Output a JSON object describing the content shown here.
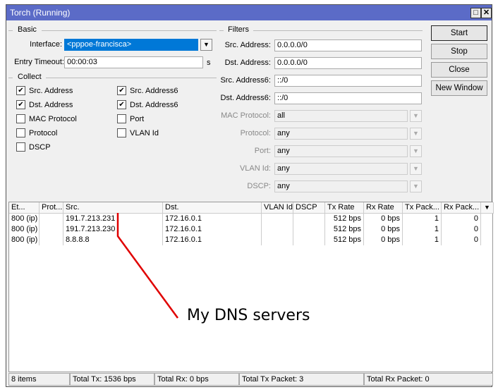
{
  "window": {
    "title": "Torch (Running)",
    "maximize_icon": "□",
    "close_icon": "✕"
  },
  "basic": {
    "label": "Basic",
    "interface_label": "Interface:",
    "interface_value": "<pppoe-francisca>",
    "entry_timeout_label": "Entry Timeout:",
    "entry_timeout_value": "00:00:03",
    "timeout_unit": "s"
  },
  "collect": {
    "label": "Collect",
    "items": [
      {
        "label": "Src. Address",
        "checked": true
      },
      {
        "label": "Dst. Address",
        "checked": true
      },
      {
        "label": "MAC Protocol",
        "checked": false
      },
      {
        "label": "Protocol",
        "checked": false
      },
      {
        "label": "DSCP",
        "checked": false
      },
      {
        "label": "Src. Address6",
        "checked": true
      },
      {
        "label": "Dst. Address6",
        "checked": true
      },
      {
        "label": "Port",
        "checked": false
      },
      {
        "label": "VLAN Id",
        "checked": false
      }
    ]
  },
  "filters": {
    "label": "Filters",
    "fields": [
      {
        "label": "Src. Address:",
        "value": "0.0.0.0/0"
      },
      {
        "label": "Dst. Address:",
        "value": "0.0.0.0/0"
      },
      {
        "label": "Src. Address6:",
        "value": "::/0"
      },
      {
        "label": "Dst. Address6:",
        "value": "::/0"
      },
      {
        "label": "MAC Protocol:",
        "value": "all"
      },
      {
        "label": "Protocol:",
        "value": "any"
      },
      {
        "label": "Port:",
        "value": "any"
      },
      {
        "label": "VLAN Id:",
        "value": "any"
      },
      {
        "label": "DSCP:",
        "value": "any"
      }
    ]
  },
  "buttons": {
    "start": "Start",
    "stop": "Stop",
    "close": "Close",
    "new_window": "New Window"
  },
  "table": {
    "columns": [
      "Et...",
      "Prot...",
      "Src.",
      "Dst.",
      "VLAN Id",
      "DSCP",
      "Tx Rate",
      "Rx Rate",
      "Tx Pack...",
      "Rx Pack..."
    ],
    "rows": [
      [
        "800 (ip)",
        "",
        "191.7.213.231",
        "172.16.0.1",
        "",
        "",
        "512 bps",
        "0 bps",
        "1",
        "0"
      ],
      [
        "800 (ip)",
        "",
        "191.7.213.230",
        "172.16.0.1",
        "",
        "",
        "512 bps",
        "0 bps",
        "1",
        "0"
      ],
      [
        "800 (ip)",
        "",
        "8.8.8.8",
        "172.16.0.1",
        "",
        "",
        "512 bps",
        "0 bps",
        "1",
        "0"
      ]
    ]
  },
  "status": {
    "items": "8 items",
    "total_tx": "Total Tx: 1536 bps",
    "total_rx": "Total Rx: 0 bps",
    "total_tx_packet": "Total Tx Packet: 3",
    "total_rx_packet": "Total Rx Packet: 0"
  },
  "annotation": {
    "text": "My DNS servers",
    "color": "#e00000"
  }
}
